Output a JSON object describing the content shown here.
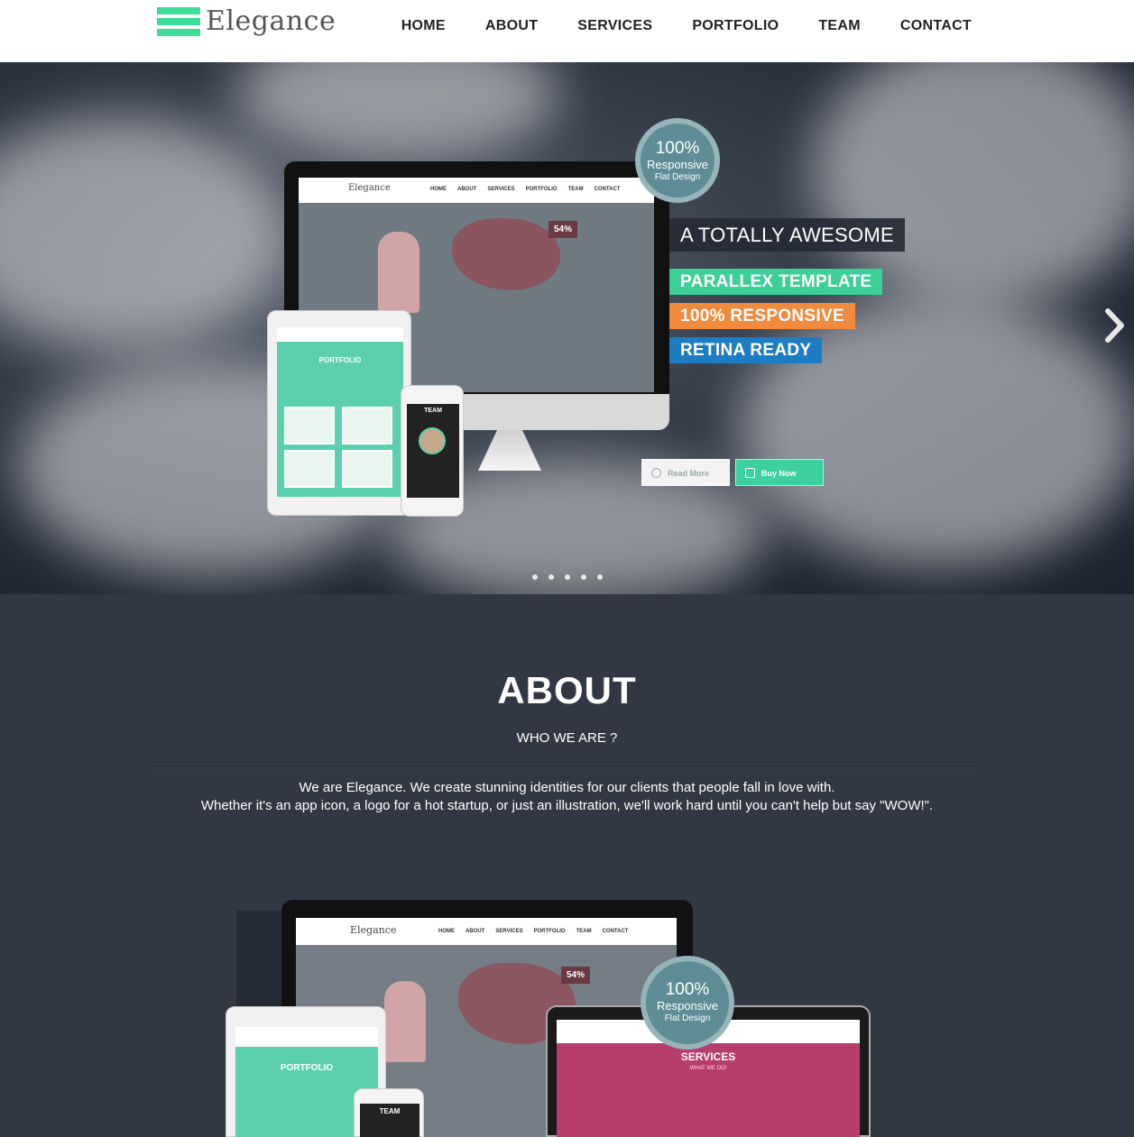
{
  "header": {
    "logo_text": "Elegance",
    "nav": [
      "HOME",
      "ABOUT",
      "SERVICES",
      "PORTFOLIO",
      "TEAM",
      "CONTACT"
    ]
  },
  "hero": {
    "badge": {
      "line1": "100%",
      "line2": "Responsive",
      "line3": "Flat Design"
    },
    "headline": "A TOTALLY AWESOME",
    "tags": [
      "PARALLEX TEMPLATE",
      "100% RESPONSIVE",
      "RETINA READY"
    ],
    "read_more": "Read More",
    "buy_now": "Buy Now",
    "mock_percent": "54%",
    "mock_tablet_title": "PORTFOLIO",
    "mock_phone_title": "TEAM",
    "slide_count": 5,
    "colors": {
      "green": "#3ccf98",
      "orange": "#f08a3c",
      "blue": "#1e7dc2",
      "badge": "#5e8d96"
    }
  },
  "about": {
    "title": "ABOUT",
    "subtitle": "WHO WE ARE ?",
    "line1": "We are Elegance. We create stunning identities for our clients that people fall in love with.",
    "line2": "Whether it's an app icon, a logo for a hot startup, or just an illustration, we'll work hard until you can't help but say \"WOW!\".",
    "mockup": {
      "badge": {
        "line1": "100%",
        "line2": "Responsive",
        "line3": "Flat Design"
      },
      "laptop_title": "SERVICES",
      "laptop_sub": "WHAT WE DO!",
      "tablet_title": "PORTFOLIO",
      "phone_title": "TEAM",
      "percent": "54%"
    }
  }
}
